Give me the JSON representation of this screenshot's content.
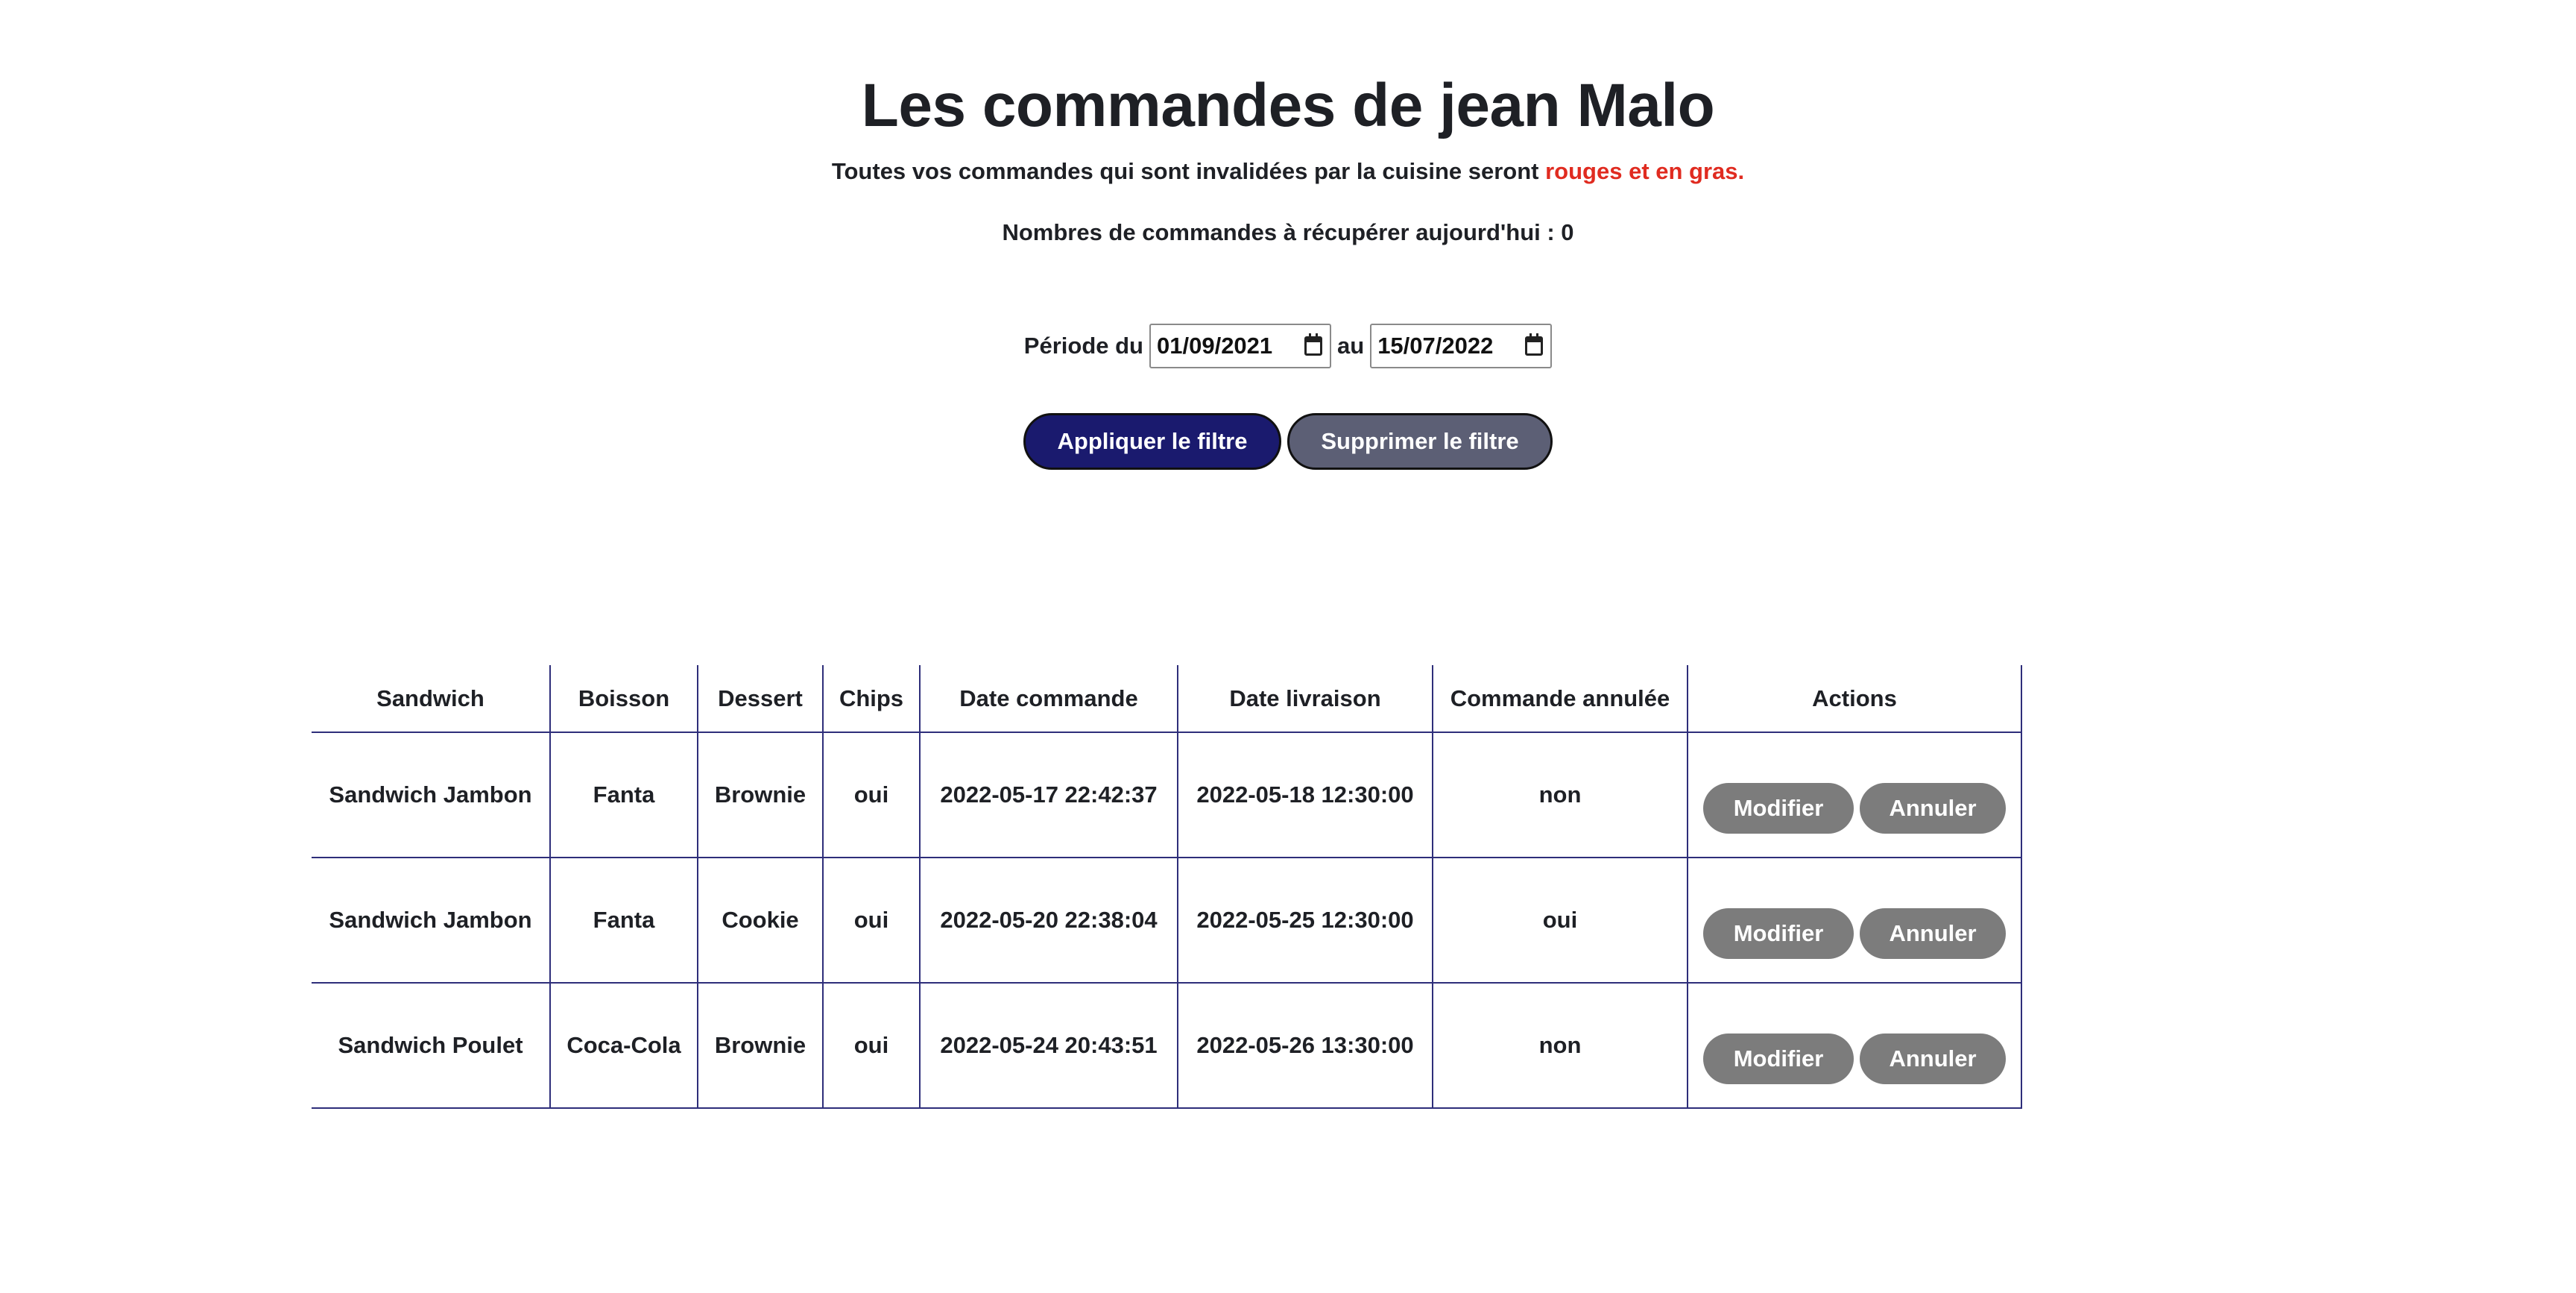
{
  "header": {
    "title": "Les commandes de jean Malo",
    "subtitle_prefix": "Toutes vos commandes qui sont invalidées par la cuisine seront ",
    "subtitle_highlight": "rouges et en gras.",
    "count_line": "Nombres de commandes à récupérer aujourd'hui : 0"
  },
  "filter": {
    "period_label": "Période du",
    "date_from": "01/09/2021",
    "between_label": "au",
    "date_to": "15/07/2022",
    "apply_label": "Appliquer le filtre",
    "remove_label": "Supprimer le filtre"
  },
  "table": {
    "headers": [
      "Sandwich",
      "Boisson",
      "Dessert",
      "Chips",
      "Date commande",
      "Date livraison",
      "Commande annulée",
      "Actions"
    ],
    "rows": [
      {
        "sandwich": "Sandwich Jambon",
        "boisson": "Fanta",
        "dessert": "Brownie",
        "chips": "oui",
        "date_commande": "2022-05-17 22:42:37",
        "date_livraison": "2022-05-18 12:30:00",
        "annulee": "non"
      },
      {
        "sandwich": "Sandwich Jambon",
        "boisson": "Fanta",
        "dessert": "Cookie",
        "chips": "oui",
        "date_commande": "2022-05-20 22:38:04",
        "date_livraison": "2022-05-25 12:30:00",
        "annulee": "oui"
      },
      {
        "sandwich": "Sandwich Poulet",
        "boisson": "Coca-Cola",
        "dessert": "Brownie",
        "chips": "oui",
        "date_commande": "2022-05-24 20:43:51",
        "date_livraison": "2022-05-26 13:30:00",
        "annulee": "non"
      }
    ],
    "modify_label": "Modifier",
    "cancel_label": "Annuler"
  },
  "colors": {
    "highlight": "#e02b20",
    "apply_button": "#1a1a6e",
    "remove_button": "#5c5f75",
    "action_button": "#7c7c7c",
    "table_border": "#2e2e7a"
  },
  "icons": {
    "date_picker": "calendar-icon"
  }
}
